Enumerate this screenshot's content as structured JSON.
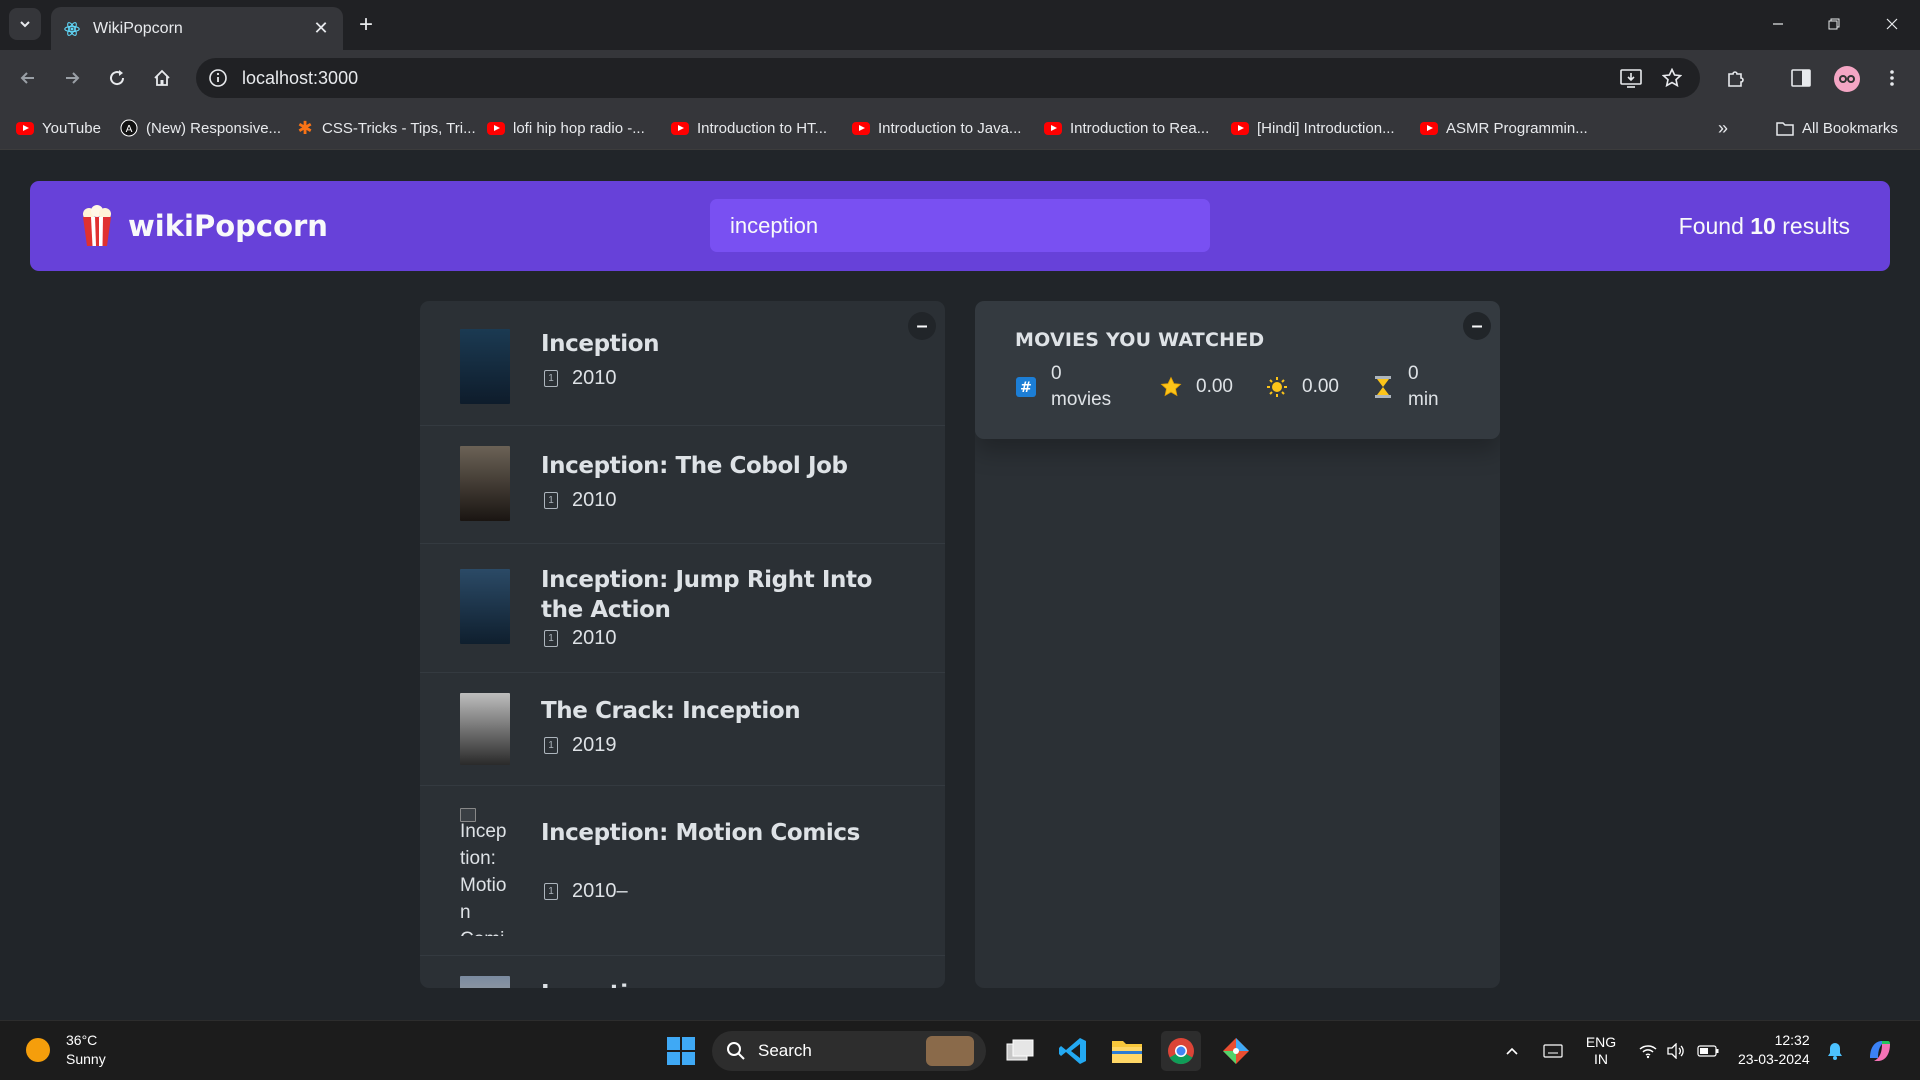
{
  "browser": {
    "tab_title": "WikiPopcorn",
    "url": "localhost:3000",
    "bookmarks": [
      {
        "label": "YouTube",
        "icon": "youtube-icon"
      },
      {
        "label": "(New) Responsive...",
        "icon": "a-logo-icon"
      },
      {
        "label": "CSS-Tricks - Tips, Tri...",
        "icon": "css-tricks-icon"
      },
      {
        "label": "lofi hip hop radio -...",
        "icon": "youtube-icon"
      },
      {
        "label": "Introduction to HT...",
        "icon": "youtube-icon"
      },
      {
        "label": "Introduction to Java...",
        "icon": "youtube-icon"
      },
      {
        "label": "Introduction to Rea...",
        "icon": "youtube-icon"
      },
      {
        "label": "[Hindi] Introduction...",
        "icon": "youtube-icon"
      },
      {
        "label": "ASMR Programmin...",
        "icon": "youtube-icon"
      }
    ],
    "all_bookmarks": "All Bookmarks"
  },
  "app": {
    "logo_text": "wikiPopcorn",
    "search_value": "inception",
    "results_prefix": "Found",
    "results_count": "10",
    "results_suffix": "results",
    "toggle_symbol": "–"
  },
  "movies": [
    {
      "title": "Inception",
      "year": "2010",
      "poster_colors": [
        "#1b3a52",
        "#0e1c2b"
      ]
    },
    {
      "title": "Inception: The Cobol Job",
      "year": "2010",
      "poster_colors": [
        "#6b6256",
        "#1a1512"
      ]
    },
    {
      "title": "Inception: Jump Right Into the Action",
      "year": "2010",
      "poster_colors": [
        "#2b4a66",
        "#0f1f2e"
      ]
    },
    {
      "title": "The Crack: Inception",
      "year": "2019",
      "poster_colors": [
        "#bdbdbd",
        "#2a2a2a"
      ]
    },
    {
      "title": "Inception: Motion Comics",
      "year": "2010–",
      "poster_alt": "Inception: Motion Comics poster"
    },
    {
      "title": "Inception",
      "year": "",
      "poster_colors": [
        "#7a8aa0",
        "#d8c8a8"
      ]
    }
  ],
  "summary": {
    "title": "Movies you watched",
    "movies_count": "0",
    "movies_label": "movies",
    "imdb_rating": "0.00",
    "user_rating": "0.00",
    "runtime": "0",
    "runtime_label": "min"
  },
  "taskbar": {
    "temperature": "36°C",
    "weather": "Sunny",
    "search_label": "Search",
    "language": "ENG",
    "region": "IN",
    "time": "12:32",
    "date": "23-03-2024"
  }
}
